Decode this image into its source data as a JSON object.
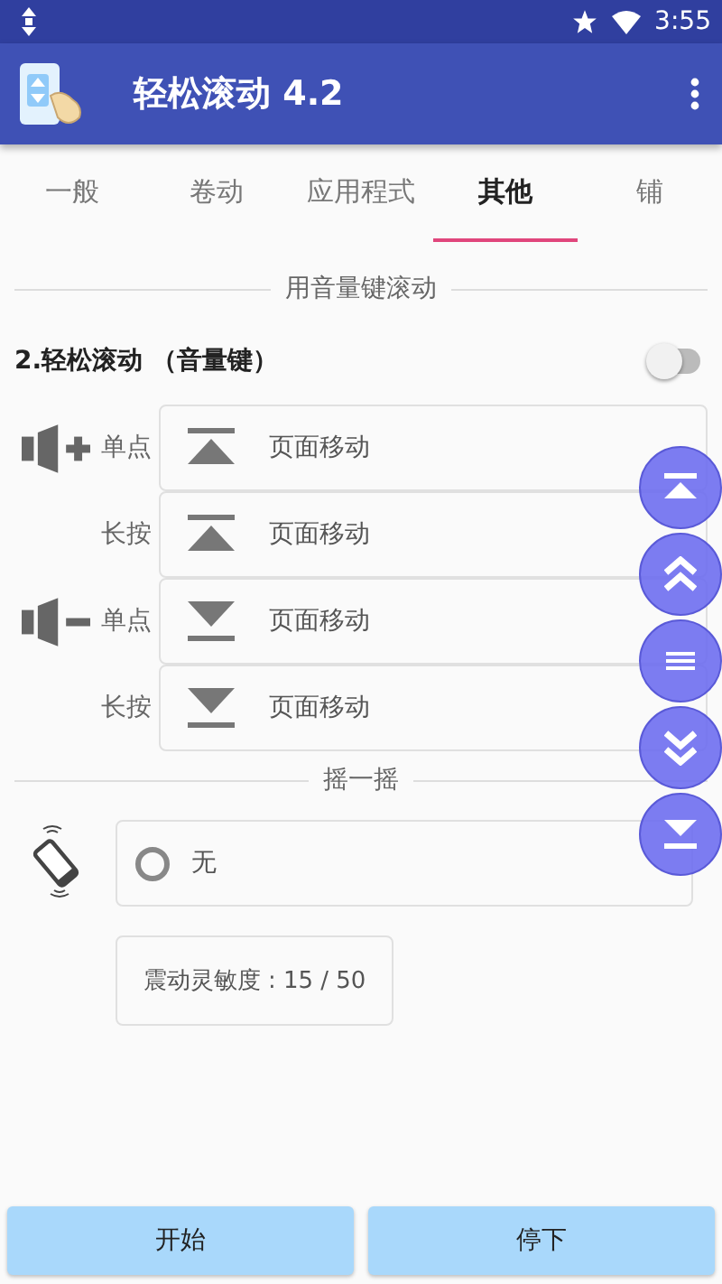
{
  "status_bar": {
    "time": "3:55"
  },
  "app_bar": {
    "title": "轻松滚动 4.2"
  },
  "tabs": [
    {
      "label": "一般",
      "selected": false
    },
    {
      "label": "卷动",
      "selected": false
    },
    {
      "label": "应用程式",
      "selected": false
    },
    {
      "label": "其他",
      "selected": true
    },
    {
      "label": "铺",
      "selected": false
    }
  ],
  "volume_section": {
    "title": "用音量键滚动",
    "toggle": {
      "label": "2.轻松滚动 （音量键）",
      "on": false
    },
    "keys": [
      {
        "kind": "volume-up",
        "actions": [
          {
            "press": "单点",
            "kind": "top",
            "action": "页面移动"
          },
          {
            "press": "长按",
            "kind": "top",
            "action": "页面移动"
          }
        ]
      },
      {
        "kind": "volume-down",
        "actions": [
          {
            "press": "单点",
            "kind": "bottom",
            "action": "页面移动"
          },
          {
            "press": "长按",
            "kind": "bottom",
            "action": "页面移动"
          }
        ]
      }
    ]
  },
  "floating_buttons": [
    {
      "kind": "top"
    },
    {
      "kind": "page-up"
    },
    {
      "kind": "menu"
    },
    {
      "kind": "page-down"
    },
    {
      "kind": "bottom"
    }
  ],
  "shake_section": {
    "title": "摇一摇",
    "option": {
      "label": "无",
      "selected": false
    },
    "sensitivity": "震动灵敏度 : 15 / 50"
  },
  "buttons": [
    "开始",
    "停下"
  ]
}
